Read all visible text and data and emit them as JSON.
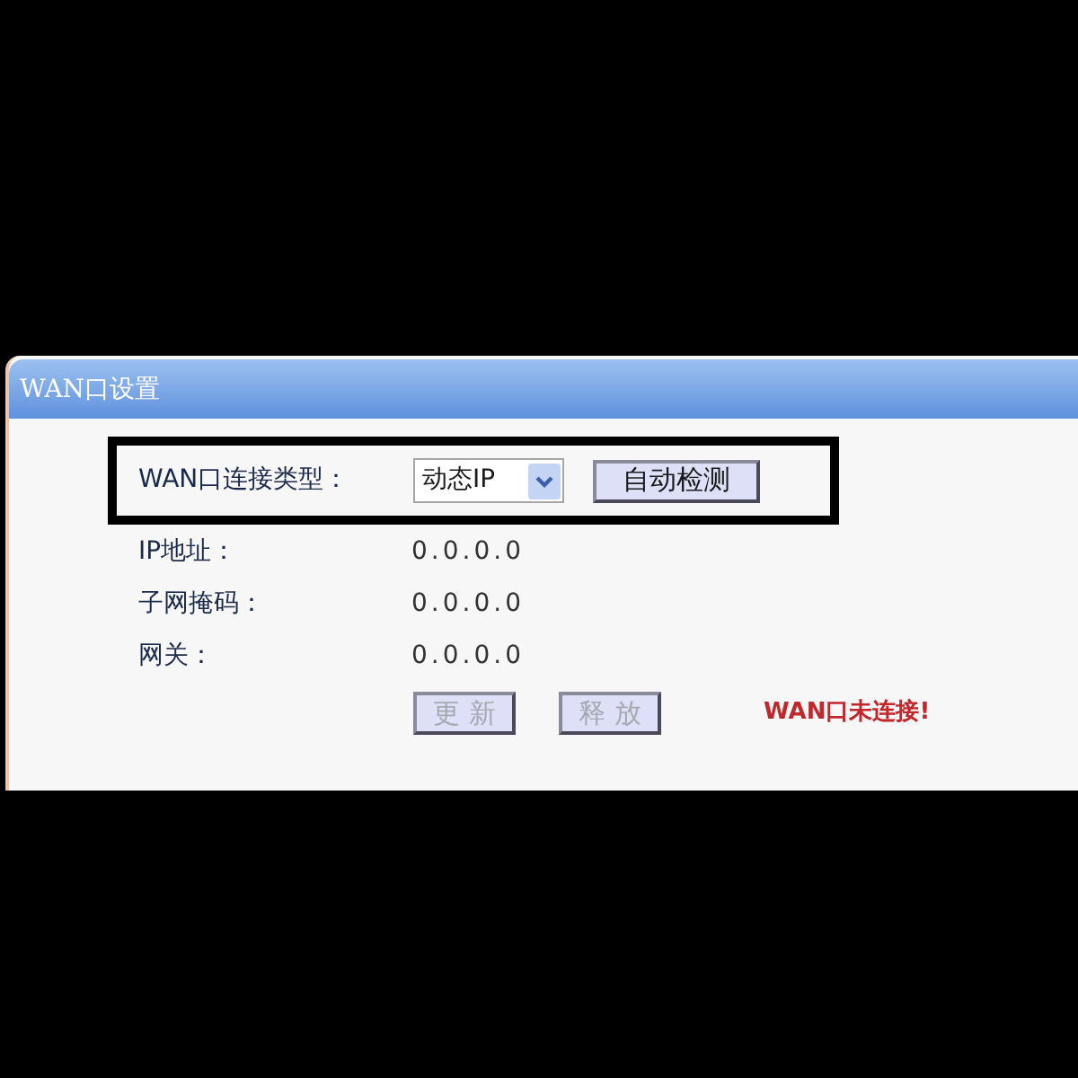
{
  "panel": {
    "title": "WAN口设置"
  },
  "connection": {
    "label": "WAN口连接类型：",
    "select": {
      "value": "动态IP"
    },
    "detect_button": {
      "label": "自动检测",
      "disabled": false
    }
  },
  "fields": [
    {
      "label": "IP地址：",
      "value": "0.0.0.0"
    },
    {
      "label": "子网掩码：",
      "value": "0.0.0.0"
    },
    {
      "label": "网关：",
      "value": "0.0.0.0"
    }
  ],
  "buttons": [
    {
      "label": "更 新",
      "disabled": true
    },
    {
      "label": "释 放",
      "disabled": true
    }
  ],
  "status": {
    "text": "WAN口未连接!"
  }
}
